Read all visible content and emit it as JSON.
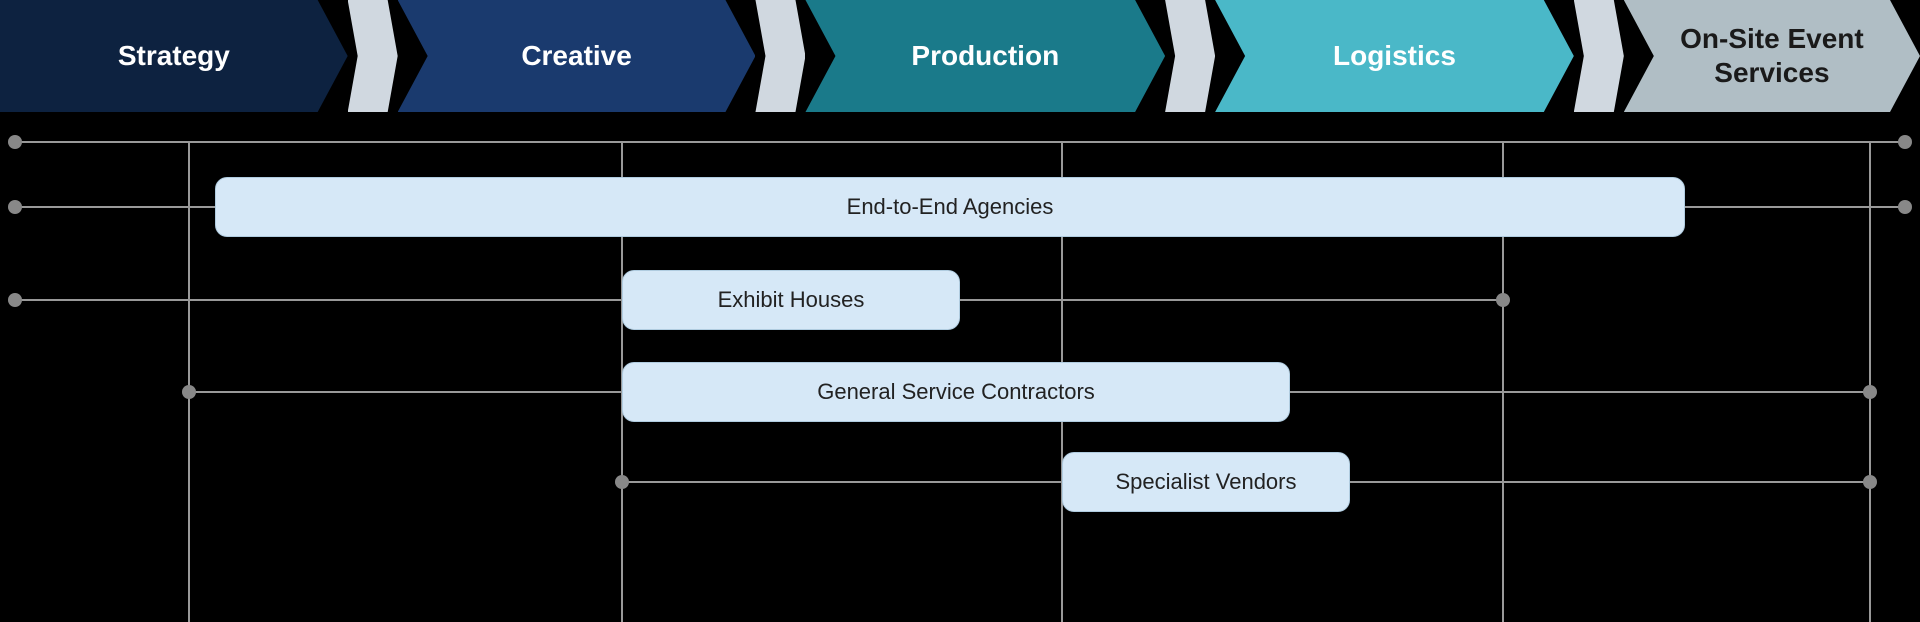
{
  "arrows": [
    {
      "id": "strategy",
      "label": "Strategy",
      "class": "arrow-strategy",
      "first": true
    },
    {
      "id": "creative",
      "label": "Creative",
      "class": "arrow-creative"
    },
    {
      "id": "production",
      "label": "Production",
      "class": "arrow-production"
    },
    {
      "id": "logistics",
      "label": "Logistics",
      "class": "arrow-logistics"
    },
    {
      "id": "onsite",
      "label": "On-Site Event\nServices",
      "class": "arrow-onsite"
    }
  ],
  "services": [
    {
      "id": "end-to-end",
      "label": "End-to-End Agencies"
    },
    {
      "id": "exhibit-houses",
      "label": "Exhibit Houses"
    },
    {
      "id": "general-service",
      "label": "General Service Contractors"
    },
    {
      "id": "specialist-vendors",
      "label": "Specialist Vendors"
    }
  ],
  "colors": {
    "line": "#999999",
    "dot": "#888888",
    "box_bg": "#d6e8f7",
    "box_border": "#b0cce0"
  }
}
